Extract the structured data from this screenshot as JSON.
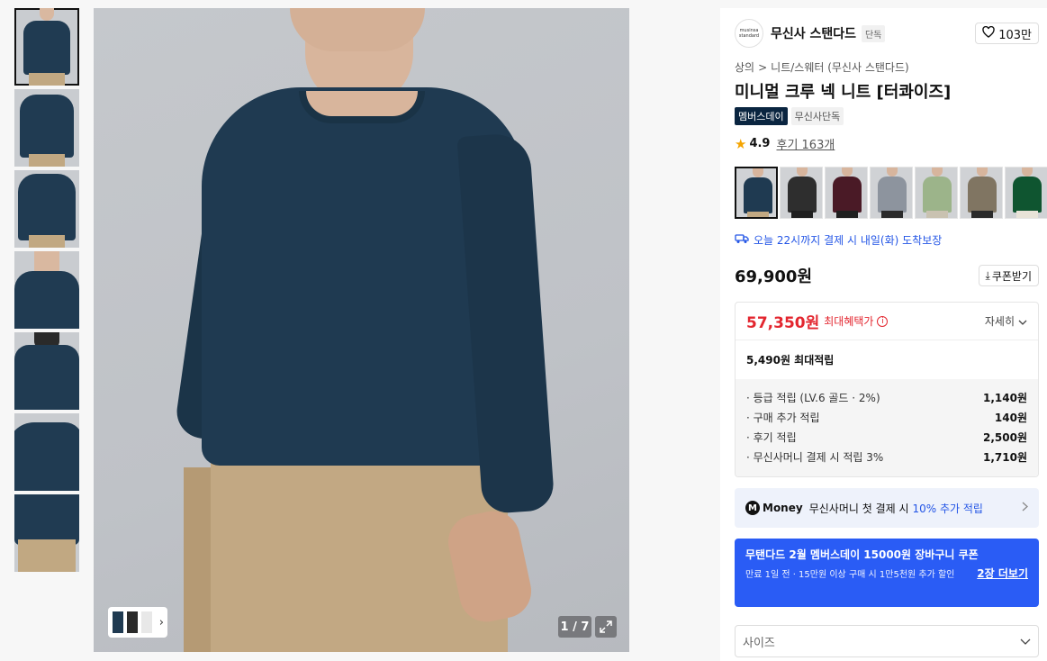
{
  "gallery": {
    "thumbnail_count": 7,
    "pager": "1 / 7"
  },
  "brand": {
    "logo_text": "musinsa standard",
    "name": "무신사 스탠다드",
    "badge": "단독",
    "likes": "103만"
  },
  "breadcrumb": {
    "level1": "상의",
    "separator": ">",
    "level2": "니트/스웨터 (무신사 스탠다드)"
  },
  "product": {
    "title": "미니멀 크루 넥 니트 [터콰이즈]",
    "tag_member": "멤버스데이",
    "tag_exclusive": "무신사단독",
    "rating": "4.9",
    "reviews": "후기 163개"
  },
  "colors": [
    {
      "name": "navy",
      "knit": "#1f3a51",
      "pants": "#c1a882"
    },
    {
      "name": "charcoal",
      "knit": "#2e2e2e",
      "pants": "#1f1f1f"
    },
    {
      "name": "burgundy",
      "knit": "#4a1a26",
      "pants": "#1f1f1f"
    },
    {
      "name": "grey",
      "knit": "#8d949e",
      "pants": "#2b2b2b"
    },
    {
      "name": "sage",
      "knit": "#9cb48a",
      "pants": "#c9c2b1"
    },
    {
      "name": "taupe",
      "knit": "#807562",
      "pants": "#2a2a2a"
    },
    {
      "name": "green",
      "knit": "#0f5530",
      "pants": "#e8e3d8"
    }
  ],
  "delivery": {
    "text": "오늘 22시까지 결제 시 내일(화) 도착보장"
  },
  "price": {
    "original": "69,900원",
    "coupon_button": "쿠폰받기",
    "sale": "57,350원",
    "sale_label": "최대혜택가",
    "detail_label": "자세히",
    "points_summary": "5,490원 최대적립",
    "points": [
      {
        "label": "· 등급 적립 (LV.6 골드 · 2%)",
        "value": "1,140원"
      },
      {
        "label": "· 구매 추가 적립",
        "value": "140원"
      },
      {
        "label": "· 후기 적립",
        "value": "2,500원"
      },
      {
        "label": "· 무신사머니 결제 시 적립 3%",
        "value": "1,710원"
      }
    ]
  },
  "money_banner": {
    "logo": "M",
    "brand": "Money",
    "text": "무신사머니 첫 결제 시",
    "highlight": "10% 추가 적립"
  },
  "promo": {
    "title": "무탠다드 2월 멤버스데이 15000원 장바구니 쿠폰",
    "subtitle": "만료 1일 전 · 15만원 이상 구매 시 1만5천원 추가 할인",
    "link": "2장 더보기"
  },
  "size_select": {
    "placeholder": "사이즈"
  },
  "colors_ui": {
    "accent_blue": "#2456e6",
    "sale_red": "#e3262f",
    "promo_bg": "#2a5cf5"
  }
}
